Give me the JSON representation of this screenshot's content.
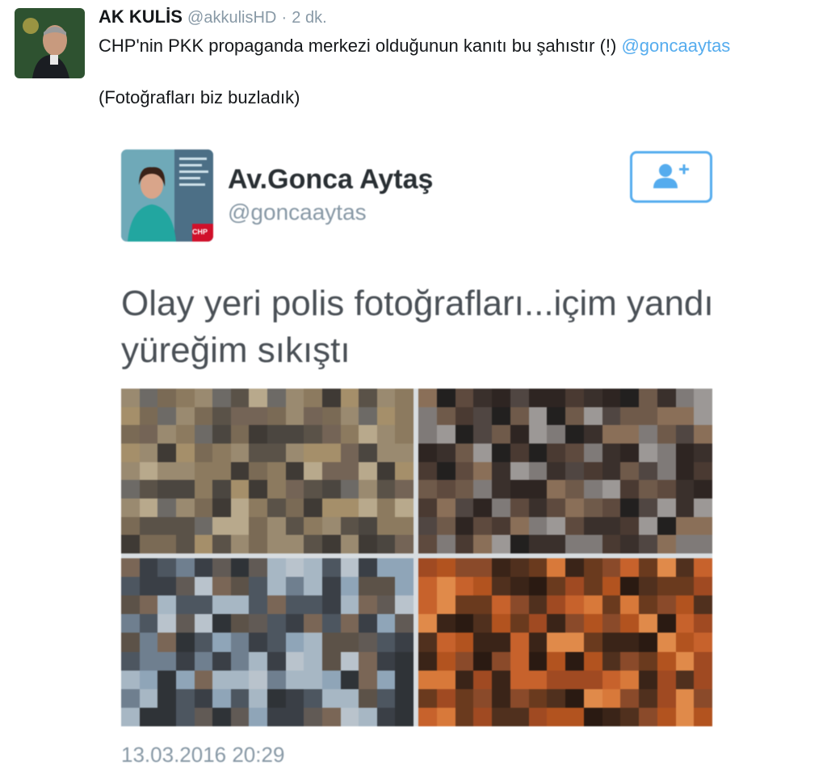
{
  "tweet": {
    "author_name": "AK KULİS",
    "author_handle": "@akkulisHD",
    "separator": "·",
    "time": "2 dk.",
    "text_before_mention": "CHP'nin PKK propaganda merkezi olduğunun kanıtı bu şahıstır (!) ",
    "mention": "@goncaaytas",
    "note": "(Fotoğrafları biz buzladık)"
  },
  "embedded_tweet": {
    "author_name": "Av.Gonca Aytaş",
    "author_handle": "@goncaaytas",
    "avatar_badge": "CHP",
    "text": "Olay yeri polis fotoğrafları...içim yandı yüreğim sıkıştı",
    "date": "13.03.2016 20:29",
    "photos_count": 4
  },
  "icons": {
    "follow": "add-user-icon"
  },
  "colors": {
    "link": "#55acee",
    "muted": "#8899a6",
    "text": "#14171a",
    "chp_red": "#d0102a"
  }
}
